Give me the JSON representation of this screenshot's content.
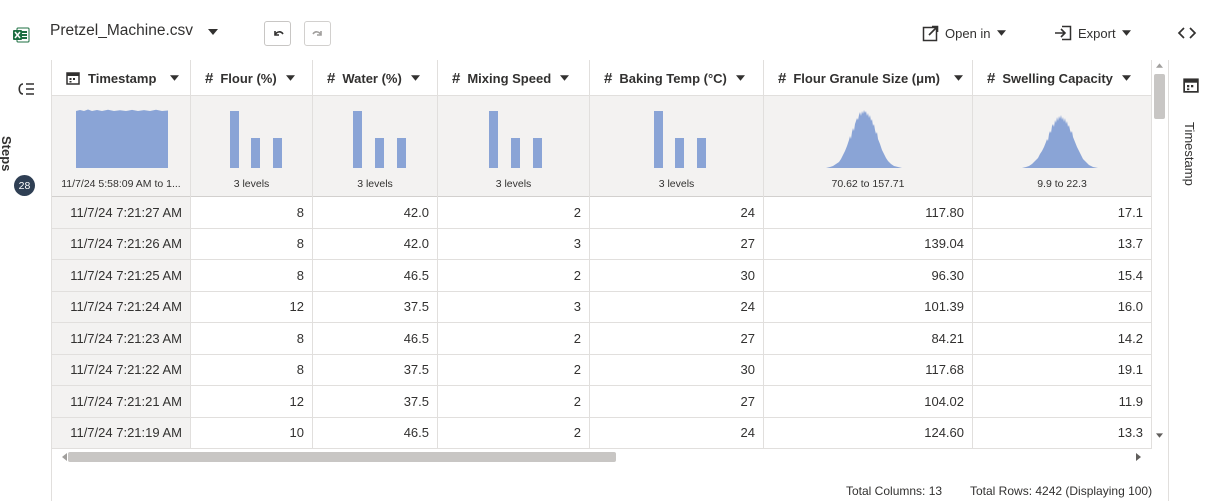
{
  "topbar": {
    "filename": "Pretzel_Machine.csv",
    "open_in_label": "Open in",
    "export_label": "Export"
  },
  "left_rail": {
    "steps_label": "Steps",
    "steps_count": "28"
  },
  "right_rail": {
    "panel_label": "Timestamp"
  },
  "columns": [
    {
      "name": "Timestamp",
      "type_icon": "calendar-icon",
      "summary": "11/7/24 5:58:09 AM to 1..."
    },
    {
      "name": "Flour (%)",
      "type_icon": "hash-icon",
      "summary": "3 levels"
    },
    {
      "name": "Water (%)",
      "type_icon": "hash-icon",
      "summary": "3 levels"
    },
    {
      "name": "Mixing Speed",
      "type_icon": "hash-icon",
      "summary": "3 levels"
    },
    {
      "name": "Baking Temp (°C)",
      "type_icon": "hash-icon",
      "summary": "3 levels"
    },
    {
      "name": "Flour Granule Size (μm)",
      "type_icon": "hash-icon",
      "summary": "70.62 to 157.71"
    },
    {
      "name": "Swelling Capacity",
      "type_icon": "hash-icon",
      "summary": "9.9 to 22.3"
    }
  ],
  "rows": [
    [
      "11/7/24 7:21:27 AM",
      "8",
      "42.0",
      "2",
      "24",
      "117.80",
      "17.1"
    ],
    [
      "11/7/24 7:21:26 AM",
      "8",
      "42.0",
      "3",
      "27",
      "139.04",
      "13.7"
    ],
    [
      "11/7/24 7:21:25 AM",
      "8",
      "46.5",
      "2",
      "30",
      "96.30",
      "15.4"
    ],
    [
      "11/7/24 7:21:24 AM",
      "12",
      "37.5",
      "3",
      "24",
      "101.39",
      "16.0"
    ],
    [
      "11/7/24 7:21:23 AM",
      "8",
      "46.5",
      "2",
      "27",
      "84.21",
      "14.2"
    ],
    [
      "11/7/24 7:21:22 AM",
      "8",
      "37.5",
      "2",
      "30",
      "117.68",
      "19.1"
    ],
    [
      "11/7/24 7:21:21 AM",
      "12",
      "37.5",
      "2",
      "27",
      "104.02",
      "11.9"
    ],
    [
      "11/7/24 7:21:19 AM",
      "10",
      "46.5",
      "2",
      "24",
      "124.60",
      "13.3"
    ]
  ],
  "footer": {
    "total_columns": "Total Columns: 13",
    "total_rows": "Total Rows: 4242 (Displaying 100)"
  },
  "colors": {
    "bar_fill": "#8aa4d6",
    "summary_bg": "#f3f2f1",
    "badge_bg": "#2f3f54",
    "excel_green": "#1d6f42"
  }
}
